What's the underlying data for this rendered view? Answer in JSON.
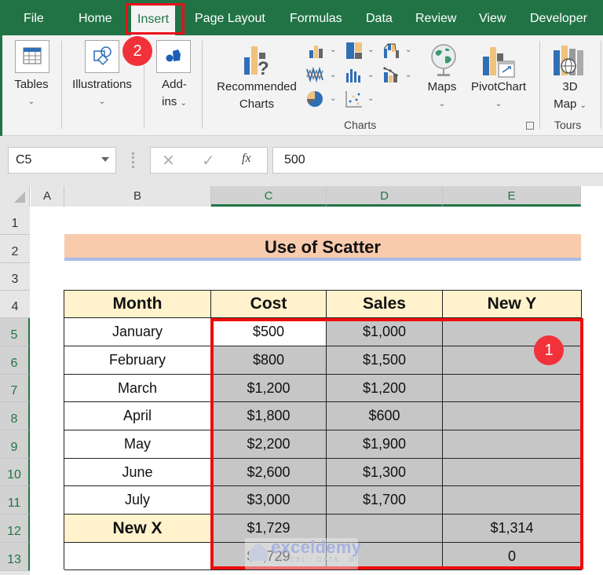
{
  "ribbon_tabs": [
    "File",
    "Home",
    "Insert",
    "Page Layout",
    "Formulas",
    "Data",
    "Review",
    "View",
    "Developer"
  ],
  "active_tab": "Insert",
  "ribbon": {
    "tables": "Tables",
    "illustrations": "Illustrations",
    "addins_line1": "Add-",
    "addins_line2": "ins",
    "recommended_line1": "Recommended",
    "recommended_line2": "Charts",
    "maps": "Maps",
    "pivotchart": "PivotChart",
    "map3d_line1": "3D",
    "map3d_line2": "Map",
    "charts_group": "Charts",
    "tours_group": "Tours",
    "chart_icons": [
      "column-chart-icon",
      "hierarchy-chart-icon",
      "waterfall-chart-icon",
      "line-chart-icon",
      "statistic-chart-icon",
      "combo-chart-icon",
      "pie-chart-icon",
      "scatter-chart-icon"
    ]
  },
  "annotations": {
    "step1": "1",
    "step2": "2"
  },
  "formula_bar": {
    "name_box": "C5",
    "cancel": "✕",
    "enter": "✓",
    "fx": "fx",
    "value": "500"
  },
  "columns": [
    "A",
    "B",
    "C",
    "D",
    "E"
  ],
  "rows": [
    "1",
    "2",
    "3",
    "4",
    "5",
    "6",
    "7",
    "8",
    "9",
    "10",
    "11",
    "12",
    "13"
  ],
  "sheet": {
    "title": "Use of Scatter",
    "headers": [
      "Month",
      "Cost",
      "Sales",
      "New Y"
    ],
    "data": [
      [
        "January",
        "$500",
        "$1,000",
        ""
      ],
      [
        "February",
        "$800",
        "$1,500",
        ""
      ],
      [
        "March",
        "$1,200",
        "$1,200",
        ""
      ],
      [
        "April",
        "$1,800",
        "$600",
        ""
      ],
      [
        "May",
        "$2,200",
        "$1,900",
        ""
      ],
      [
        "June",
        "$2,600",
        "$1,300",
        ""
      ],
      [
        "July",
        "$3,000",
        "$1,700",
        ""
      ],
      [
        "New X",
        "$1,729",
        "",
        "$1,314"
      ],
      [
        "",
        "$1,729",
        "",
        "0"
      ]
    ]
  },
  "watermark": {
    "name": "exceldemy",
    "tagline": "EXCEL · DATA · BI"
  },
  "colors": {
    "excel_green": "#217346",
    "highlight_red": "#e8101a",
    "title_fill": "#f8cbad",
    "header_fill": "#fff2cc",
    "selection_fill": "#c6c6c6",
    "badge_red": "#f1323a"
  }
}
